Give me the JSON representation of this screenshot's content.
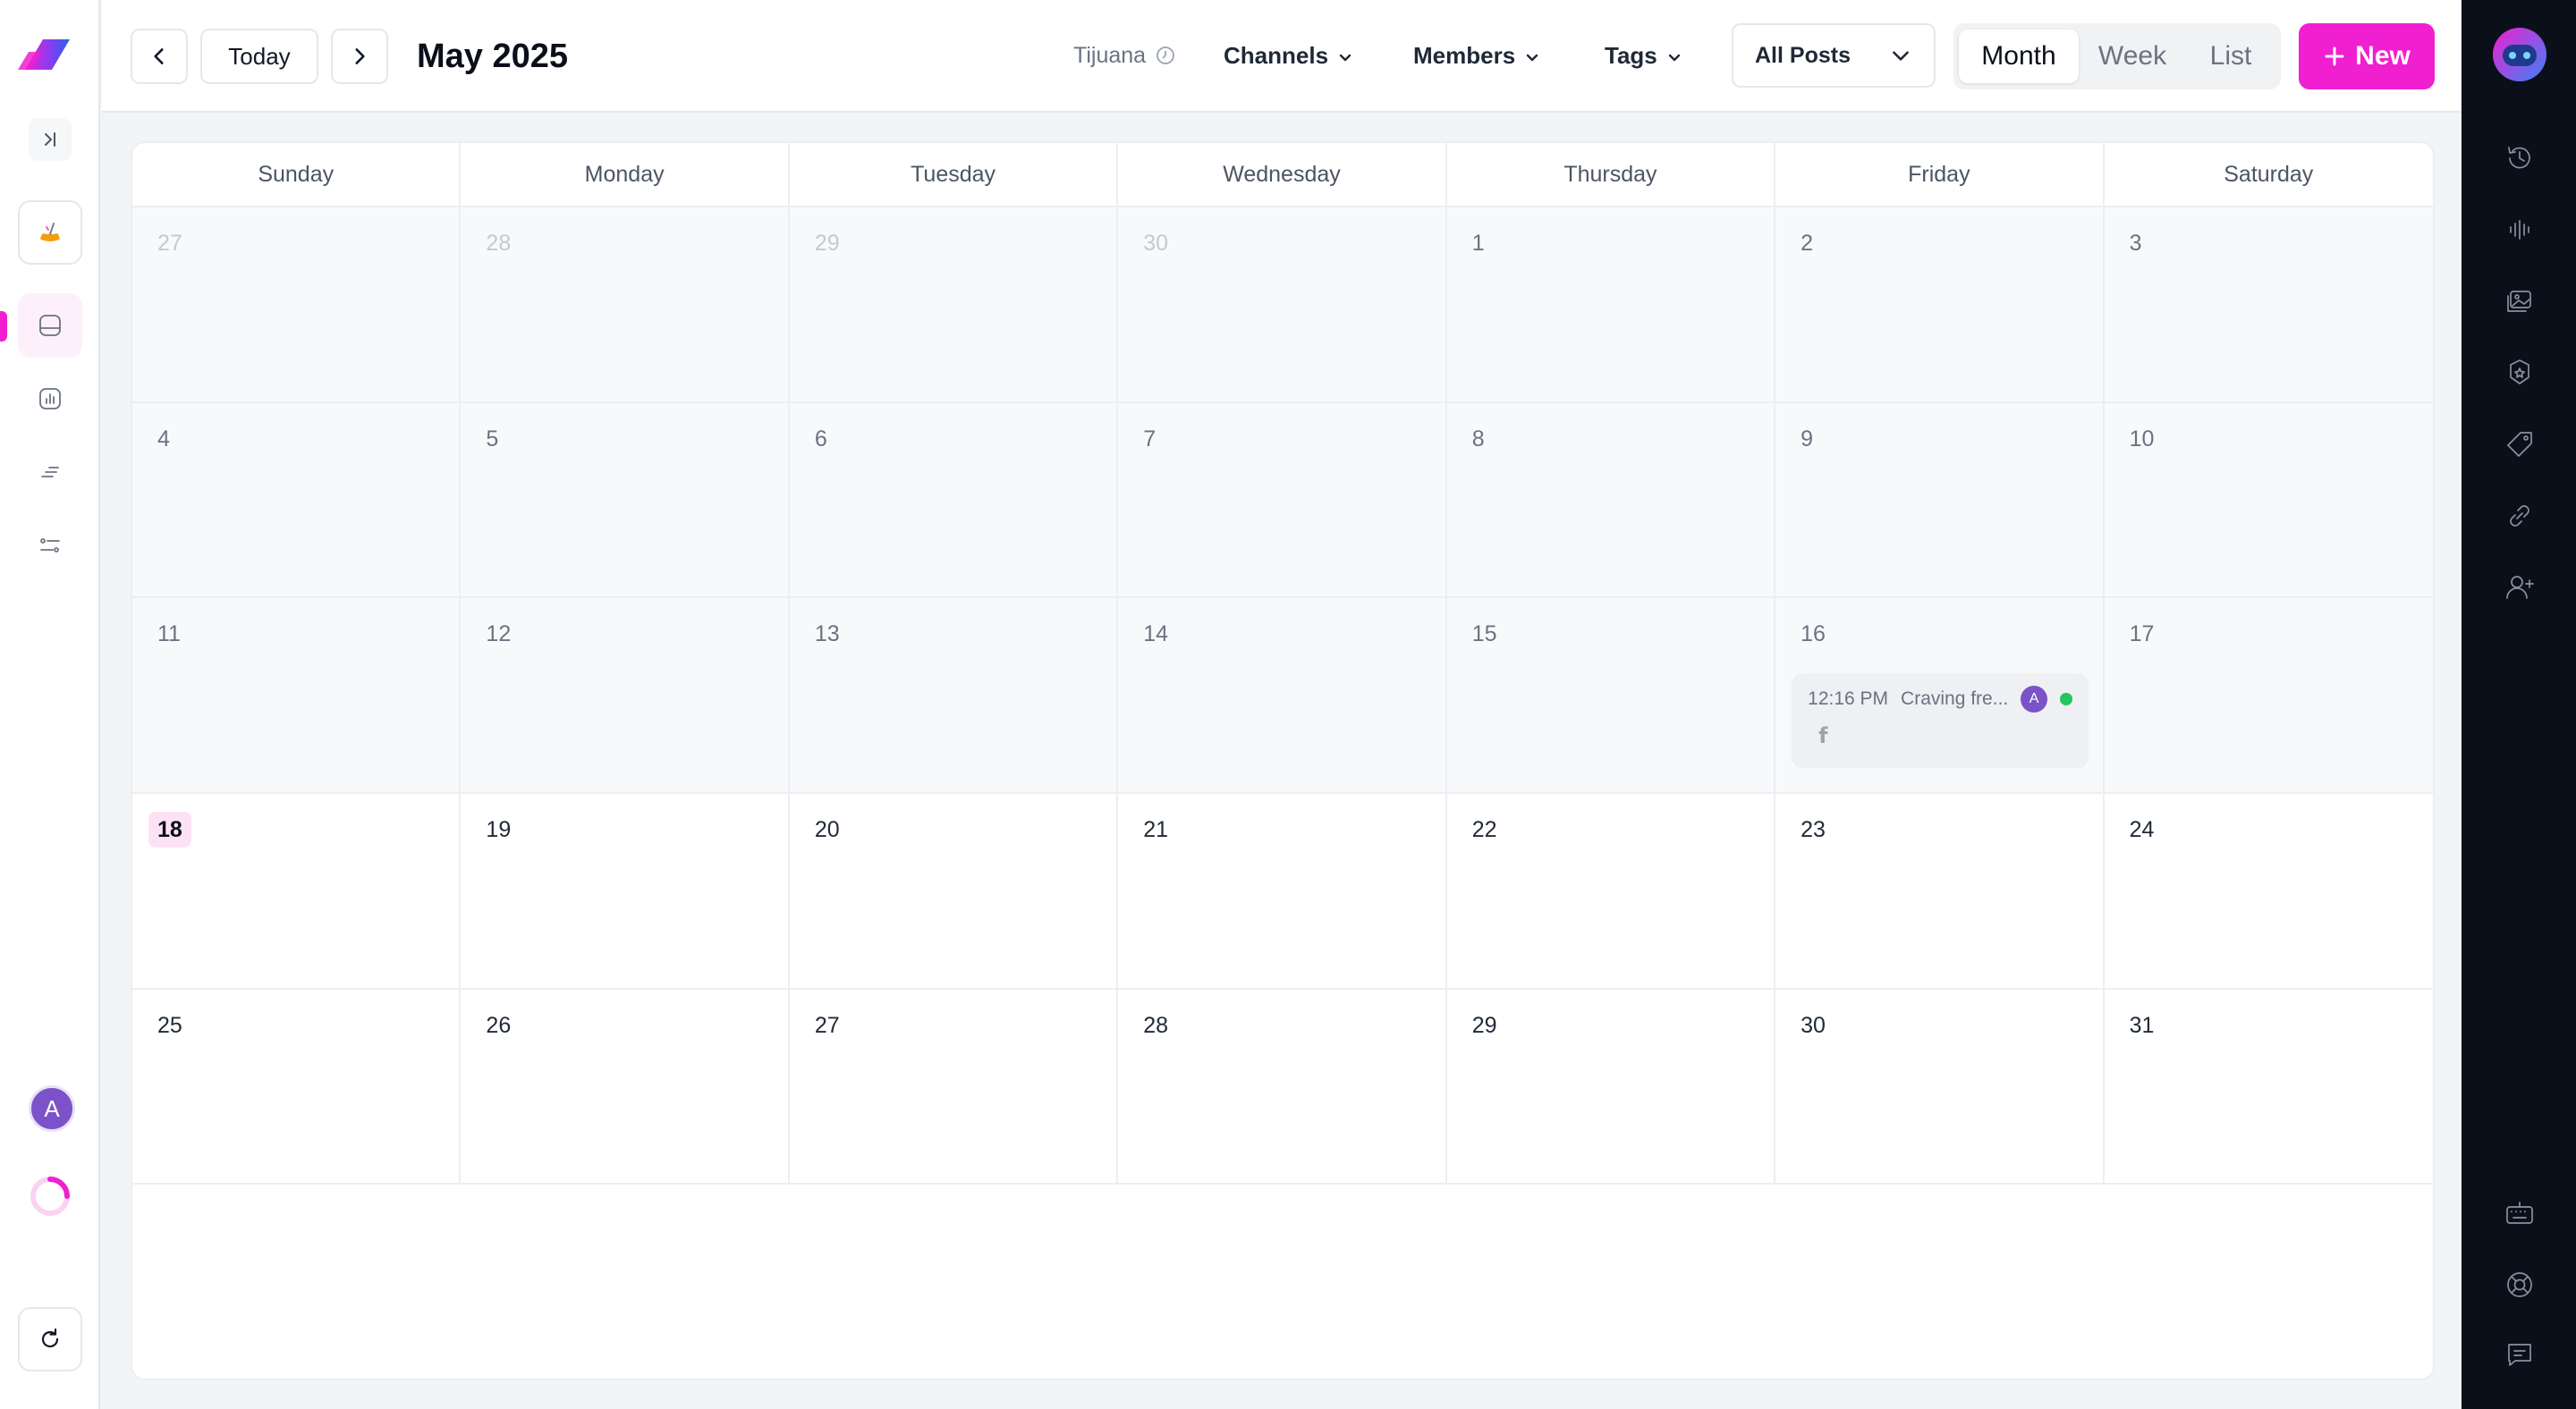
{
  "toolbar": {
    "today_label": "Today",
    "month_title": "May 2025",
    "timezone": "Tijuana",
    "filters": [
      {
        "label": "Channels"
      },
      {
        "label": "Members"
      },
      {
        "label": "Tags"
      }
    ],
    "post_filter_value": "All Posts",
    "views": [
      "Month",
      "Week",
      "List"
    ],
    "selected_view": "Month",
    "new_label": "New"
  },
  "left_sidebar": {
    "avatar_initial": "A",
    "icons": [
      "logo",
      "collapse-icon",
      "brush-icon",
      "calendar-icon",
      "analytics-icon",
      "list-icon",
      "settings-sliders-icon",
      "refresh-icon"
    ]
  },
  "right_sidebar": {
    "icons": [
      "assistant-bot-icon",
      "history-icon",
      "audio-wave-icon",
      "media-gallery-icon",
      "badge-icon",
      "tag-icon",
      "link-icon",
      "add-user-icon",
      "keyboard-icon",
      "support-icon",
      "chat-icon"
    ]
  },
  "calendar": {
    "weekdays": [
      "Sunday",
      "Monday",
      "Tuesday",
      "Wednesday",
      "Thursday",
      "Friday",
      "Saturday"
    ],
    "weeks": [
      [
        "27",
        "28",
        "29",
        "30",
        "1",
        "2",
        "3"
      ],
      [
        "4",
        "5",
        "6",
        "7",
        "8",
        "9",
        "10"
      ],
      [
        "11",
        "12",
        "13",
        "14",
        "15",
        "16",
        "17"
      ],
      [
        "18",
        "19",
        "20",
        "21",
        "22",
        "23",
        "24"
      ],
      [
        "25",
        "26",
        "27",
        "28",
        "29",
        "30",
        "31"
      ]
    ],
    "today": "18",
    "post": {
      "time": "12:16 PM",
      "title": "Craving fre...",
      "author_initial": "A",
      "channel": "f",
      "status_color": "#22c55e"
    }
  },
  "colors": {
    "accent": "#f01fd0",
    "avatar": "#7c52c9",
    "right_sidebar_bg": "#0b0f1a"
  }
}
